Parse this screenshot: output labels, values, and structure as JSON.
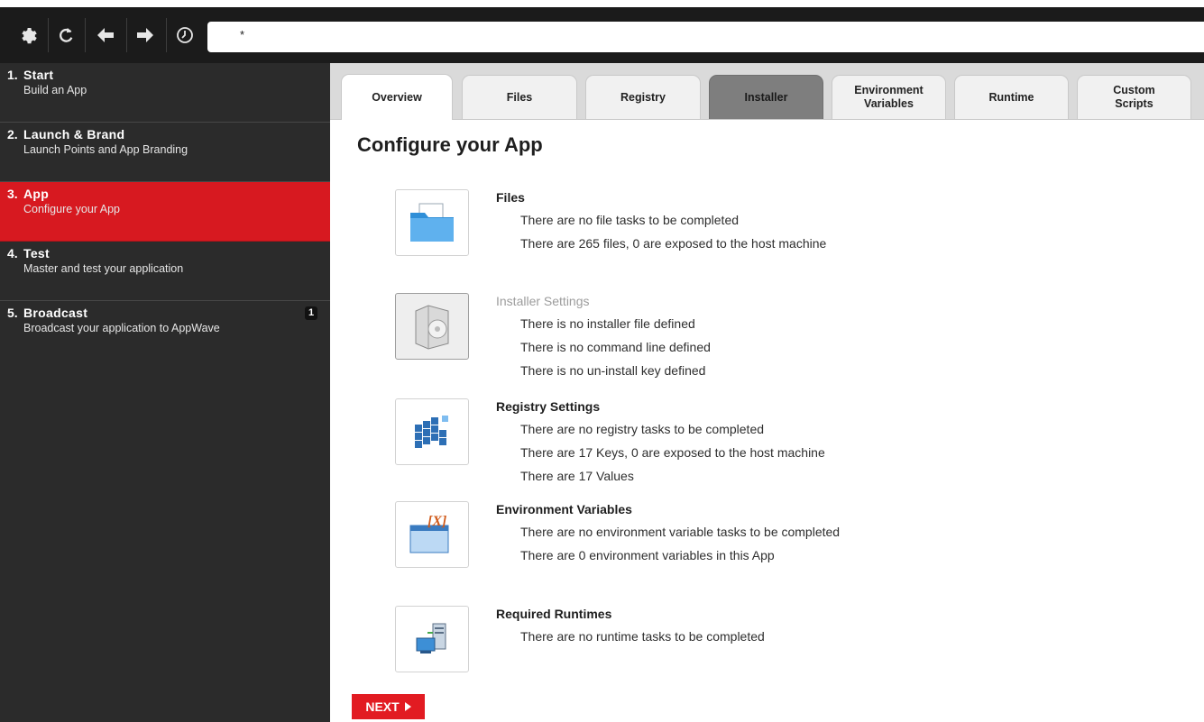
{
  "address_bar": {
    "value": "*"
  },
  "sidebar": {
    "steps": [
      {
        "number": "1.",
        "title": "Start",
        "subtitle": "Build an App",
        "active": false
      },
      {
        "number": "2.",
        "title": "Launch & Brand",
        "subtitle": "Launch Points and App Branding",
        "active": false
      },
      {
        "number": "3.",
        "title": "App",
        "subtitle": "Configure your App",
        "active": true
      },
      {
        "number": "4.",
        "title": "Test",
        "subtitle": "Master and test your application",
        "active": false
      },
      {
        "number": "5.",
        "title": "Broadcast",
        "subtitle": "Broadcast your application to AppWave",
        "active": false,
        "badge": "1"
      }
    ]
  },
  "tabs": [
    {
      "label": "Overview",
      "state": "active"
    },
    {
      "label": "Files",
      "state": "normal"
    },
    {
      "label": "Registry",
      "state": "normal"
    },
    {
      "label": "Installer",
      "state": "dark"
    },
    {
      "label": "Environment Variables",
      "state": "normal"
    },
    {
      "label": "Runtime",
      "state": "normal"
    },
    {
      "label": "Custom Scripts",
      "state": "normal"
    }
  ],
  "page_title": "Configure your App",
  "sections": [
    {
      "title": "Files",
      "disabled": false,
      "icon": "folder-icon",
      "lines": [
        "There are no file tasks to be completed",
        "There are 265 files, 0 are exposed to the host machine"
      ]
    },
    {
      "title": "Installer Settings",
      "disabled": true,
      "icon": "installer-box-icon",
      "lines": [
        "There is no installer file defined",
        "There is no command line defined",
        "There is no un-install key defined"
      ]
    },
    {
      "title": "Registry Settings",
      "disabled": false,
      "icon": "registry-cubes-icon",
      "lines": [
        "There are no registry tasks to be completed",
        "There are 17 Keys, 0 are exposed to the host machine",
        "There are 17 Values"
      ]
    },
    {
      "title": "Environment Variables",
      "disabled": false,
      "icon": "environment-window-icon",
      "lines": [
        "There are no environment variable tasks to be completed",
        "There are 0 environment variables in this App"
      ]
    },
    {
      "title": "Required Runtimes",
      "disabled": false,
      "icon": "runtime-server-icon",
      "lines": [
        "There are no runtime tasks to be completed"
      ]
    }
  ],
  "next_button": {
    "label": "NEXT"
  },
  "colors": {
    "accent": "#d71920",
    "sidebar_bg": "#2b2b2b",
    "toolbar_bg": "#1b1b1b",
    "tab_dark": "#7e7e7e"
  }
}
